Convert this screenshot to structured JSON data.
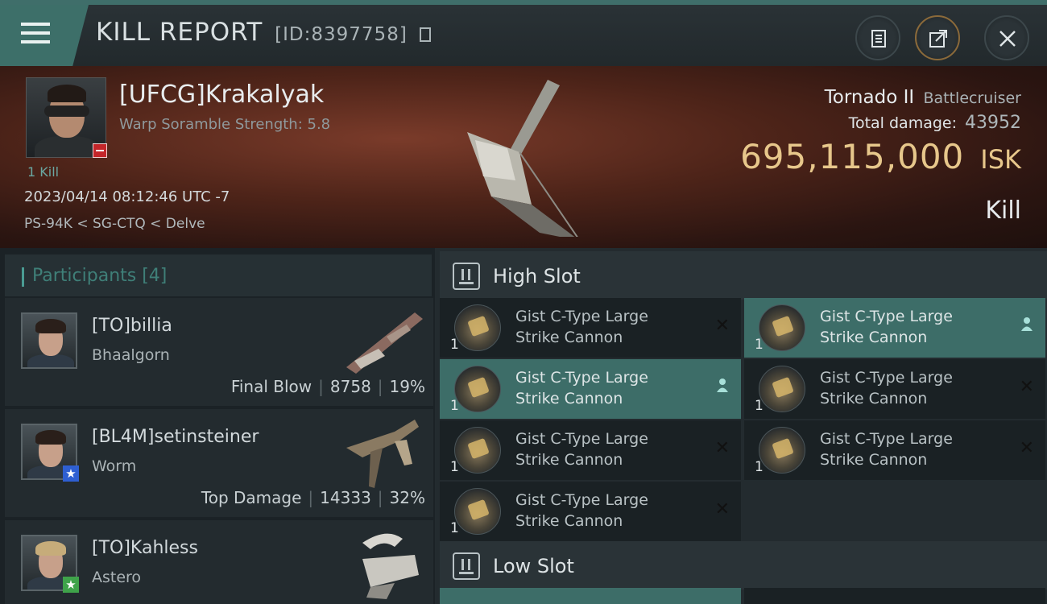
{
  "header": {
    "title": "KILL REPORT",
    "id_text": "[ID:8397758]",
    "icons": [
      "menu-icon",
      "copy-icon",
      "clipboard-icon",
      "share-icon",
      "close-icon"
    ]
  },
  "victim": {
    "name": "[UFCG]Krakalyak",
    "sub": "Warp Soramble Strength: 5.8",
    "kills": "1 Kill",
    "datetime": "2023/04/14 08:12:46 UTC -7",
    "location": "PS-94K < SG-CTQ < Delve",
    "ship_name": "Tornado II",
    "ship_class": "Battlecruiser",
    "damage_label": "Total damage:",
    "damage_value": "43952",
    "isk_value": "695,115,000",
    "isk_unit": "ISK",
    "result": "Kill"
  },
  "participants": {
    "title": "Participants [4]",
    "items": [
      {
        "name": "[TO]billia",
        "ship": "Bhaalgorn",
        "role": "Final Blow",
        "damage": "8758",
        "percent": "19%"
      },
      {
        "name": "[BL4M]setinsteiner",
        "ship": "Worm",
        "role": "Top Damage",
        "damage": "14333",
        "percent": "32%"
      },
      {
        "name": "[TO]Kahless",
        "ship": "Astero"
      }
    ]
  },
  "fitting": {
    "high_slot_title": "High Slot",
    "low_slot_title": "Low Slot",
    "high_modules": [
      {
        "line1": "Gist C-Type Large",
        "line2": "Strike Cannon",
        "qty": "1",
        "state": "destroyed"
      },
      {
        "line1": "Gist C-Type Large",
        "line2": "Strike Cannon",
        "qty": "1",
        "state": "dropped"
      },
      {
        "line1": "Gist C-Type Large",
        "line2": "Strike Cannon",
        "qty": "1",
        "state": "dropped"
      },
      {
        "line1": "Gist C-Type Large",
        "line2": "Strike Cannon",
        "qty": "1",
        "state": "destroyed"
      },
      {
        "line1": "Gist C-Type Large",
        "line2": "Strike Cannon",
        "qty": "1",
        "state": "destroyed"
      },
      {
        "line1": "Gist C-Type Large",
        "line2": "Strike Cannon",
        "qty": "1",
        "state": "destroyed"
      },
      {
        "line1": "Gist C-Type Large",
        "line2": "Strike Cannon",
        "qty": "1",
        "state": "destroyed"
      }
    ]
  },
  "colors": {
    "accent": "#3d6f69",
    "isk": "#e7c78b",
    "star_blue": "#2e5fd2",
    "star_green": "#3fa34a"
  }
}
